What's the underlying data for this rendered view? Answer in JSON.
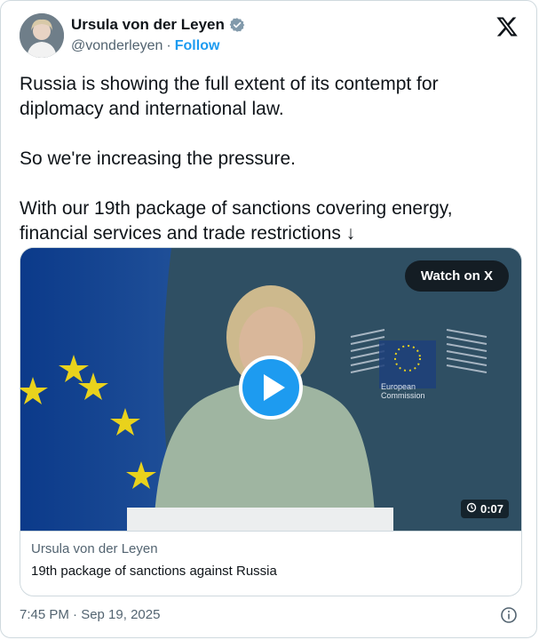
{
  "author": {
    "name": "Ursula von der Leyen",
    "handle": "@vonderleyen",
    "separator": "·",
    "follow_label": "Follow",
    "avatar_icon": "profile-photo",
    "verified_icon": "verified-badge-icon"
  },
  "brand": {
    "logo_icon": "x-logo-icon"
  },
  "tweet": {
    "text": "Russia is showing the full extent of its contempt for diplomacy and international law.\n\nSo we're increasing the pressure.\n\nWith our 19th package of sanctions covering energy, financial services and trade restrictions ↓"
  },
  "media": {
    "watch_label": "Watch on X",
    "duration": "0:07",
    "play_icon": "play-icon",
    "overlay_text": "European\nCommission",
    "footer_author": "Ursula von der Leyen",
    "footer_title": "19th package of sanctions against Russia"
  },
  "meta": {
    "timestamp": "7:45 PM · Sep 19, 2025",
    "info_icon": "info-icon"
  },
  "colors": {
    "accent": "#1d9bf0",
    "text": "#0f1419",
    "muted": "#536471",
    "border": "#cfd9de"
  }
}
